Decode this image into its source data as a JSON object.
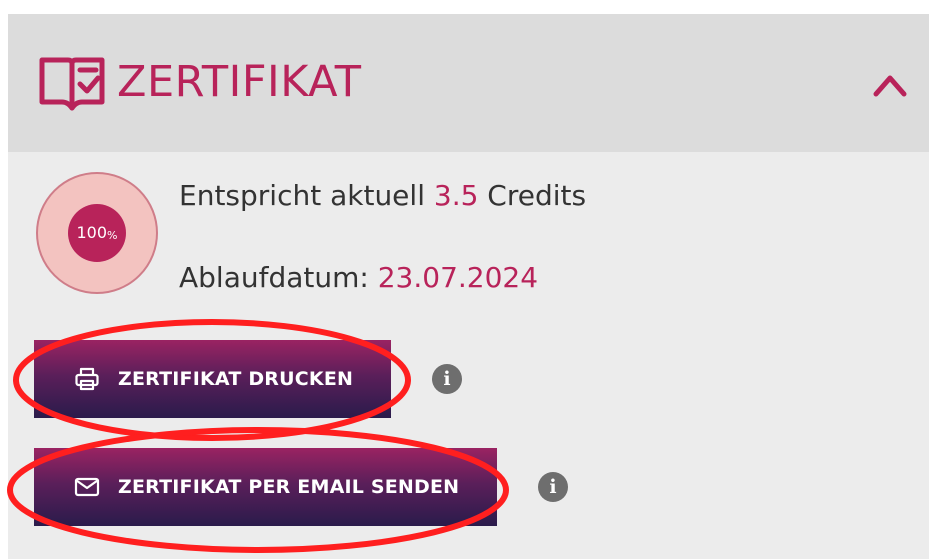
{
  "header": {
    "title": "ZERTIFIKAT",
    "icon": "book-check-icon",
    "collapse_icon": "chevron-up-icon",
    "accent_color": "#b8235a"
  },
  "progress": {
    "value": "100",
    "symbol": "%",
    "fill_fraction": 1.0
  },
  "info": {
    "credits_prefix": "Entspricht aktuell ",
    "credits_value": "3.5",
    "credits_suffix": " Credits",
    "expiry_label": "Ablaufdatum: ",
    "expiry_value": "23.07.2024"
  },
  "actions": {
    "print_label": "ZERTIFIKAT DRUCKEN",
    "print_icon": "printer-icon",
    "email_label": "ZERTIFIKAT PER EMAIL SENDEN",
    "email_icon": "envelope-icon",
    "info_glyph": "i"
  },
  "annotation": {
    "color": "#ff1f1f"
  }
}
